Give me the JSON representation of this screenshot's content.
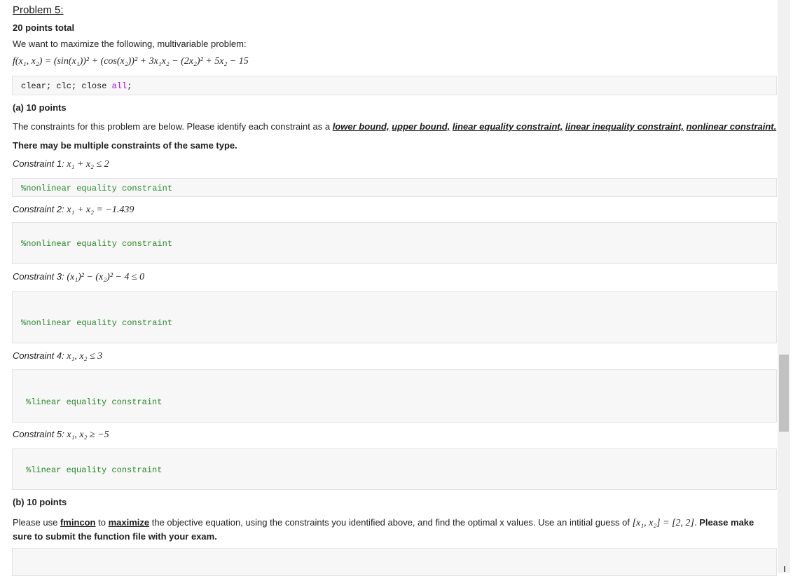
{
  "problem_title": "Problem 5:",
  "points_total": "20 points total",
  "intro": "We want to maximize the following, multivariable problem:",
  "objective": "f(x₁, x₂) = (sin(x₁))² + (cos(x₂))² + 3x₁x₂ − (2x₂)² + 5x₂ − 15",
  "code_cell_1": {
    "part1": "clear; clc; close ",
    "part2": "all",
    "part3": ";"
  },
  "part_a": {
    "heading": "(a) 10 points",
    "instr_prefix": "The constraints for this problem are below. Please identify each constraint as a ",
    "types": [
      "lower bound,",
      "upper bound,",
      "linear equality constraint,",
      "linear inequality constraint,",
      "nonlinear constraint."
    ],
    "note": "There may be multiple constraints of the same type.",
    "constraints": [
      {
        "label": "Constraint 1:",
        "expr": "x₁ + x₂ ≤ 2",
        "answer": "%nonlinear equality constraint"
      },
      {
        "label": "Constraint 2:",
        "expr": "x₁ + x₂ = −1.439",
        "answer": "%nonlinear equality constraint"
      },
      {
        "label": "Constraint 3:",
        "expr": "(x₁)² − (x₂)² − 4 ≤ 0",
        "answer": "%nonlinear equality constraint"
      },
      {
        "label": "Constraint 4:",
        "expr": "x₁, x₂ ≤ 3",
        "answer": "%linear equality constraint"
      },
      {
        "label": "Constraint 5:",
        "expr": "x₁, x₂ ≥ −5",
        "answer": "%linear equality constraint"
      }
    ]
  },
  "part_b": {
    "heading": "(b) 10 points",
    "t1": "Please use ",
    "fmincon": "fmincon",
    "t2": " to ",
    "maximize": "maximize",
    "t3": " the objective equation, using the constraints you identified above, and find the optimal x values. Use an intitial guess of ",
    "guess": "[x₁, x₂] = [2, 2]",
    "t4": ". ",
    "bold_end_1": "Please make sure to",
    "bold_end_2": "submit the function file with your exam."
  }
}
